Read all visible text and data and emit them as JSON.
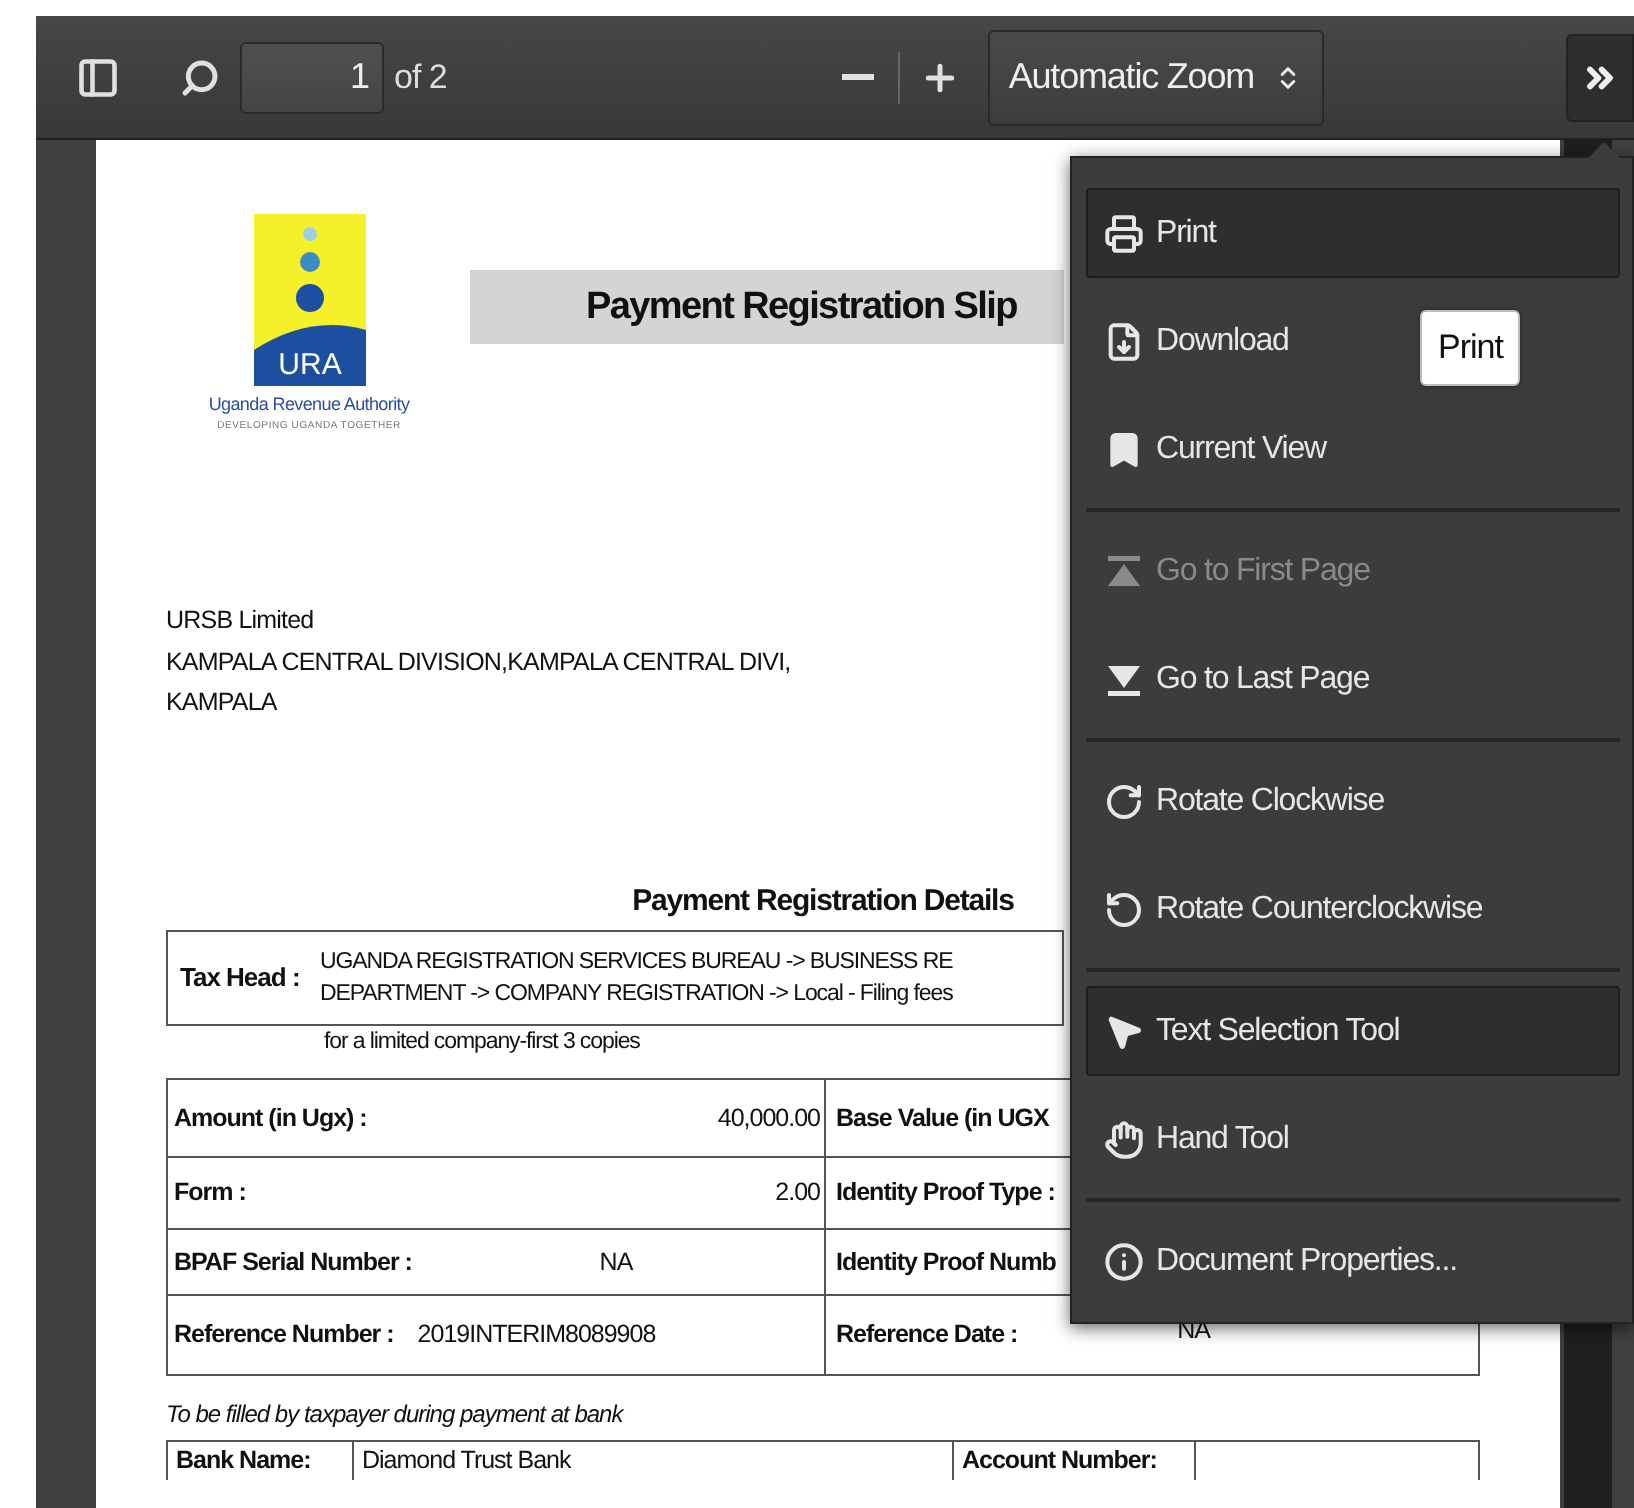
{
  "toolbar": {
    "page_input": {
      "value": "1"
    },
    "page_count": "of 2",
    "zoom_select": {
      "value": "Automatic Zoom"
    }
  },
  "document": {
    "logo": {
      "acronym": "URA",
      "name": "Uganda Revenue Authority",
      "tagline": "DEVELOPING UGANDA TOGETHER"
    },
    "title": "Payment Registration Slip",
    "address_lines": [
      "URSB Limited",
      "KAMPALA CENTRAL DIVISION,KAMPALA CENTRAL DIVI,",
      "KAMPALA"
    ],
    "section_title": "Payment Registration Details",
    "tax_head": {
      "label": "Tax Head :",
      "lines": [
        "UGANDA REGISTRATION SERVICES BUREAU -> BUSINESS RE",
        "DEPARTMENT -> COMPANY REGISTRATION -> Local - Filing fees",
        "for a limited company-first 3 copies"
      ]
    },
    "rows": [
      {
        "left_label": "Amount (in Ugx) :",
        "left_value": "40,000.00",
        "right_label": "Base Value (in UGX"
      },
      {
        "left_label": "Form :",
        "left_value": "2.00",
        "right_label": "Identity Proof Type :"
      },
      {
        "left_label": "BPAF Serial Number :",
        "left_value": "NA",
        "right_label": "Identity Proof Numb"
      },
      {
        "left_label": "Reference Number :",
        "left_value": "2019INTERIM8089908",
        "right_label": "Reference Date :",
        "right_value": "NA"
      }
    ],
    "note": "To be filled by taxpayer during payment at bank",
    "bank_row": [
      "Bank Name:",
      "Diamond Trust Bank",
      "Account Number:"
    ]
  },
  "menu": {
    "open": true,
    "sections": [
      {
        "items": [
          {
            "label": "Print",
            "highlighted": true,
            "disabled": false
          },
          {
            "label": "Download",
            "highlighted": false,
            "disabled": false
          },
          {
            "label": "Current View",
            "highlighted": false,
            "disabled": false
          }
        ]
      },
      {
        "items": [
          {
            "label": "Go to First Page",
            "highlighted": false,
            "disabled": true
          },
          {
            "label": "Go to Last Page",
            "highlighted": false,
            "disabled": false
          }
        ]
      },
      {
        "items": [
          {
            "label": "Rotate Clockwise",
            "highlighted": false,
            "disabled": false
          },
          {
            "label": "Rotate Counterclockwise",
            "highlighted": false,
            "disabled": false
          }
        ]
      },
      {
        "items": [
          {
            "label": "Text Selection Tool",
            "highlighted": true,
            "disabled": false
          },
          {
            "label": "Hand Tool",
            "highlighted": false,
            "disabled": false
          }
        ]
      },
      {
        "items": [
          {
            "label": "Document Properties...",
            "highlighted": false,
            "disabled": false
          }
        ]
      }
    ]
  },
  "tooltip": {
    "text": "Print"
  }
}
